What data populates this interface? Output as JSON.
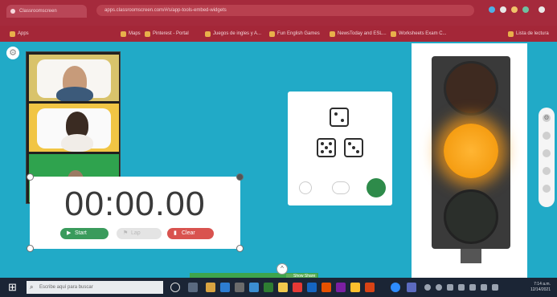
{
  "browser": {
    "tab_title": "Classroomscreen",
    "address": "apps.classroomscreen.com/#/s/app-tools-embed-widgets",
    "bookmarks": [
      "Apps",
      "Maps",
      "Pinterest - Portal",
      "Juegos de ingles y A...",
      "Fun English Games",
      "NewsToday and ESL...",
      "Worksheets Exam C...",
      "Lista de lectura"
    ]
  },
  "timer": {
    "display": "00:00.00",
    "start_label": "Start",
    "lap_label": "Lap",
    "clear_label": "Clear"
  },
  "dice": {
    "faces": [
      2,
      5,
      3
    ]
  },
  "traffic_light": {
    "active": "yellow"
  },
  "share": {
    "label": "Show Share"
  },
  "taskbar": {
    "search_placeholder": "Escribe aquí para buscar",
    "time": "7:14 a.m.",
    "date": "12/14/2021"
  },
  "colors": {
    "canvas": "#21aac7",
    "browser_chrome": "#a52a3c",
    "start_button": "#3a9b5c",
    "clear_button": "#d9534f",
    "light_active": "#f59d12"
  }
}
